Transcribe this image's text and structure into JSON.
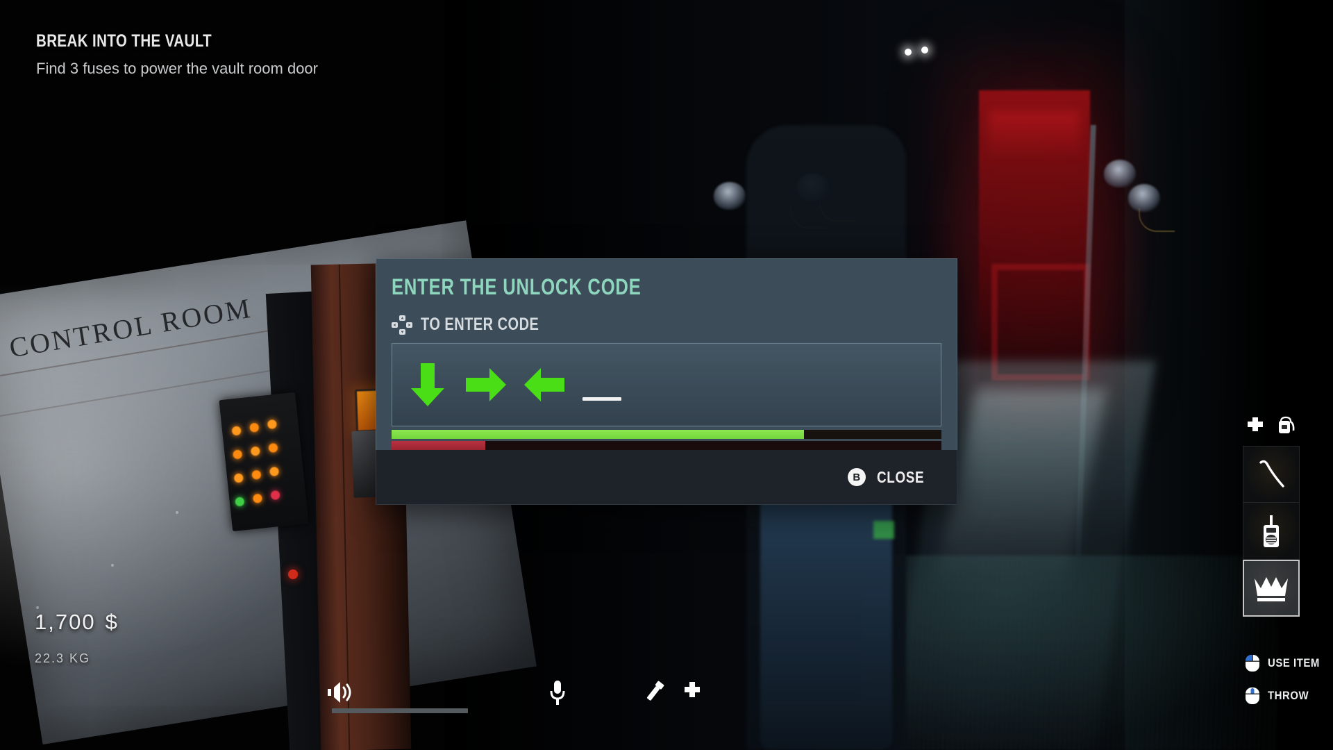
{
  "objective": {
    "title": "BREAK INTO THE VAULT",
    "subtitle": "Find 3 fuses to power the vault room door"
  },
  "scene": {
    "control_room_sign": "CONTROL ROOM"
  },
  "hud": {
    "money": "1,700",
    "currency": "$",
    "weight": "22.3 KG",
    "volume_icon": "speaker-icon",
    "microphone_icon": "microphone-icon",
    "flashlight_icon": "flashlight-icon",
    "health_icon": "health-cross-icon"
  },
  "inventory": {
    "health_icon": "health-cross-icon",
    "backpack_icon": "backpack-icon",
    "slots": [
      {
        "name": "crowbar",
        "icon": "crowbar-icon",
        "selected": false
      },
      {
        "name": "walkie-talkie",
        "icon": "walkie-talkie-icon",
        "selected": false
      },
      {
        "name": "crown",
        "icon": "crown-icon",
        "selected": true
      }
    ]
  },
  "prompts": [
    {
      "label": "USE ITEM",
      "icon": "mouse-left-click-icon"
    },
    {
      "label": "THROW",
      "icon": "mouse-middle-click-icon"
    }
  ],
  "dialog": {
    "title": "ENTER THE UNLOCK CODE",
    "hint_icon": "dpad-icon",
    "hint_text": "TO ENTER CODE",
    "code_sequence": [
      "down",
      "right",
      "left"
    ],
    "pending_slots": 1,
    "arrow_color": "#4ade16",
    "progress": {
      "green_percent": 75,
      "red_percent": 17,
      "green_color": "#8ce84f",
      "red_color": "#b8313f"
    },
    "close_button": {
      "glyph": "B",
      "label": "CLOSE"
    },
    "title_color": "#8ed6bd",
    "header_color": "#3c4c59",
    "footer_color": "#1e2229"
  }
}
